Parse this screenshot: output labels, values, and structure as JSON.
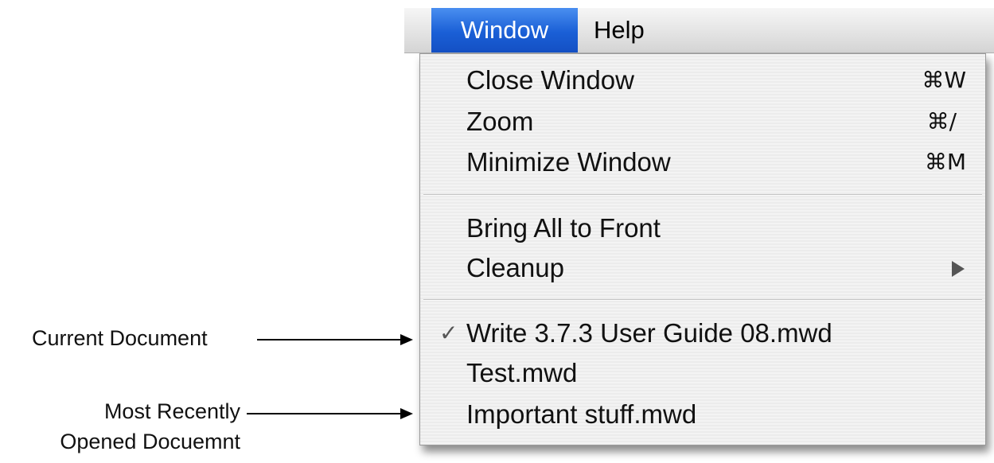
{
  "menubar": {
    "window_label": "Window",
    "help_label": "Help"
  },
  "menu": {
    "items": [
      {
        "label": "Close Window",
        "shortcut": "⌘W"
      },
      {
        "label": "Zoom",
        "shortcut": "⌘/"
      },
      {
        "label": "Minimize Window",
        "shortcut": "⌘M"
      },
      {
        "label": "Bring All to Front"
      },
      {
        "label": "Cleanup",
        "submenu": true
      },
      {
        "label": "Write 3.7.3 User Guide 08.mwd",
        "checked": true,
        "check_mark": "✓"
      },
      {
        "label": "Test.mwd"
      },
      {
        "label": "Important stuff.mwd"
      }
    ]
  },
  "annotations": {
    "current_document": "Current Document",
    "most_recent_line1": "Most Recently",
    "most_recent_line2": "Opened Docuemnt"
  },
  "colors": {
    "highlight": "#1a5fd6",
    "menu_bg": "#f0f0f0"
  },
  "icons": {
    "cleanup_submenu": "triangle-right-icon",
    "checkmark": "check-icon"
  }
}
